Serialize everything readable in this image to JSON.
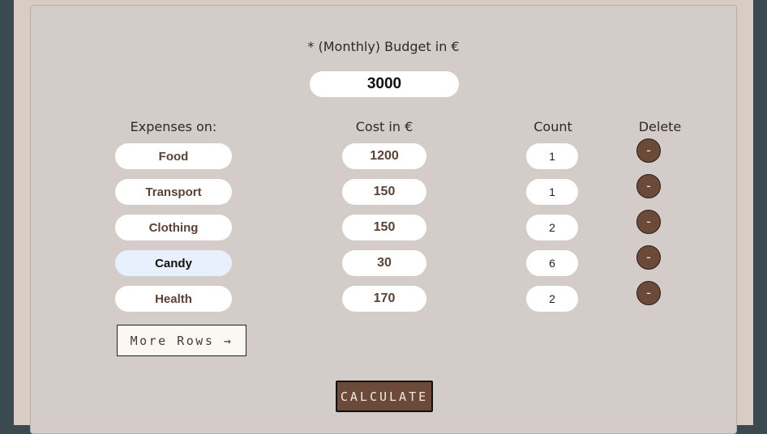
{
  "budget": {
    "label": "* (Monthly) Budget in €",
    "value": "3000"
  },
  "columns": {
    "expenses": "Expenses on:",
    "cost": "Cost in €",
    "count": "Count",
    "delete": "Delete"
  },
  "rows": [
    {
      "name": "Food",
      "cost": "1200",
      "count": "1",
      "delete": "-"
    },
    {
      "name": "Transport",
      "cost": "150",
      "count": "1",
      "delete": "-"
    },
    {
      "name": "Clothing",
      "cost": "150",
      "count": "2",
      "delete": "-"
    },
    {
      "name": "Candy",
      "cost": "30",
      "count": "6",
      "delete": "-"
    },
    {
      "name": "Health",
      "cost": "170",
      "count": "2",
      "delete": "-"
    }
  ],
  "actions": {
    "more_rows": "More Rows →",
    "calculate": "CALCULATE"
  },
  "colors": {
    "accent": "#6b4a3a",
    "panel": "#d3ccc8",
    "focus": "#e8f0fe"
  }
}
